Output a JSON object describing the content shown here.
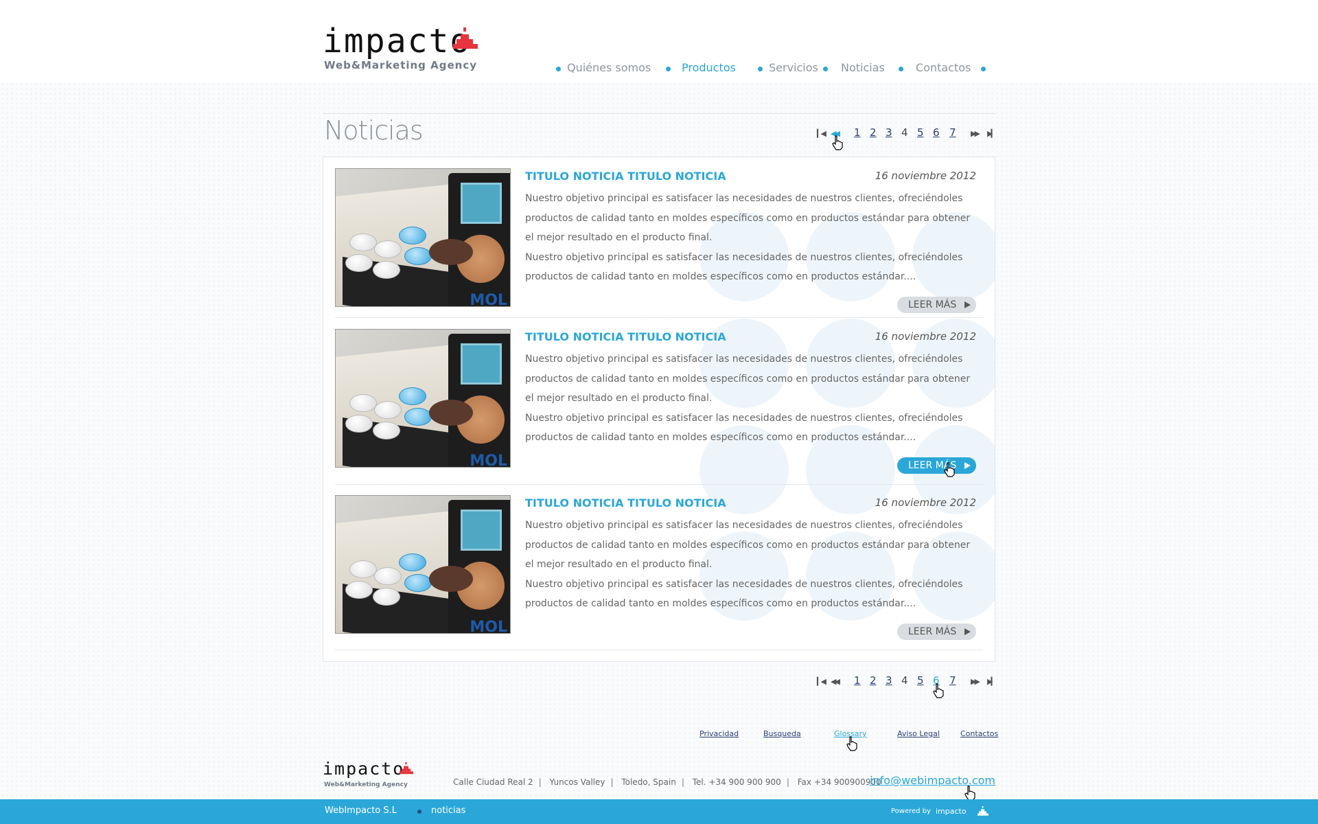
{
  "brand": {
    "name": "impacto",
    "tagline": "Web&Marketing Agency"
  },
  "nav": {
    "items": [
      {
        "label": "Quiénes somos",
        "active": false
      },
      {
        "label": "Productos",
        "active": true
      },
      {
        "label": "Servicios",
        "active": false
      },
      {
        "label": "Noticias",
        "active": false
      },
      {
        "label": "Contactos",
        "active": false
      }
    ]
  },
  "page": {
    "title": "Noticias"
  },
  "pagination": {
    "pages": [
      "1",
      "2",
      "3",
      "4",
      "5",
      "6",
      "7"
    ],
    "current": "4",
    "first_icon": "first-page-icon",
    "prev_icon": "previous-page-icon",
    "next_icon": "next-page-icon",
    "last_icon": "last-page-icon"
  },
  "news": [
    {
      "title": "TITULO NOTICIA TITULO NOTICIA",
      "date": "16 noviembre 2012",
      "para1": "Nuestro objetivo principal es satisfacer las necesidades de nuestros clientes, ofreciéndoles productos de calidad tanto en moldes específicos como en productos estándar para obtener el mejor resultado en el producto final.",
      "para2": "Nuestro objetivo principal es satisfacer las necesidades de nuestros clientes, ofreciéndoles productos de calidad tanto en moldes específicos como en productos estándar....",
      "more": "LEER MÁS"
    },
    {
      "title": "TITULO NOTICIA TITULO NOTICIA",
      "date": "16 noviembre 2012",
      "para1": "Nuestro objetivo principal es satisfacer las necesidades de nuestros clientes, ofreciéndoles productos de calidad tanto en moldes específicos como en productos estándar para obtener el mejor resultado en el producto final.",
      "para2": "Nuestro objetivo principal es satisfacer las necesidades de nuestros clientes, ofreciéndoles productos de calidad tanto en moldes específicos como en productos estándar....",
      "more": "LEER MÁS"
    },
    {
      "title": "TITULO NOTICIA TITULO NOTICIA",
      "date": "16 noviembre 2012",
      "para1": "Nuestro objetivo principal es satisfacer las necesidades de nuestros clientes, ofreciéndoles productos de calidad tanto en moldes específicos como en productos estándar para obtener el mejor resultado en el producto final.",
      "para2": "Nuestro objetivo principal es satisfacer las necesidades de nuestros clientes, ofreciéndoles productos de calidad tanto en moldes específicos como en productos estándar....",
      "more": "LEER MÁS"
    }
  ],
  "footer": {
    "links": [
      "Privacidad",
      "Busqueda",
      "Glossary",
      "Aviso Legal",
      "Contactos"
    ],
    "address": [
      "Calle Ciudad Real 2",
      "Yuncos Valley",
      "Toledo, Spain",
      "Tel. +34 900 900 900",
      "Fax +34 900900900"
    ],
    "email": "info@webimpacto.com",
    "company": "WebImpacto S.L",
    "breadcrumb": "noticias",
    "powered_by": "Powered by",
    "powered_brand": "impacto"
  },
  "colors": {
    "accent": "#2aa7d8",
    "brand_red": "#e8343f",
    "text": "#666666"
  }
}
